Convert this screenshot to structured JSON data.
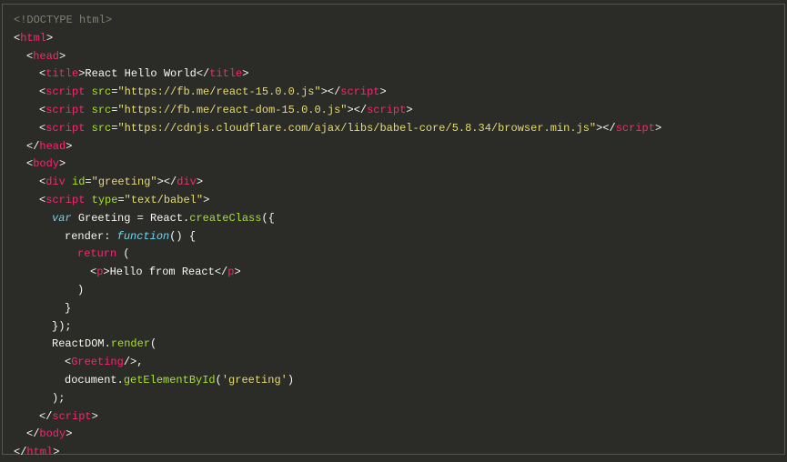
{
  "code": {
    "doctype": "<!DOCTYPE html>",
    "tags": {
      "html": "html",
      "head": "head",
      "title": "title",
      "script": "script",
      "body": "body",
      "div": "div",
      "p": "p",
      "greeting": "Greeting"
    },
    "attrs": {
      "src": "src",
      "id": "id",
      "type": "type"
    },
    "values": {
      "title_text": "React Hello World",
      "src1": "\"https://fb.me/react-15.0.0.js\"",
      "src2": "\"https://fb.me/react-dom-15.0.0.js\"",
      "src3": "\"https://cdnjs.cloudflare.com/ajax/libs/babel-core/5.8.34/browser.min.js\"",
      "div_id": "\"greeting\"",
      "script_type": "\"text/babel\"",
      "hello_text": "Hello from React",
      "greeting_id": "'greeting'"
    },
    "js": {
      "var": "var",
      "greeting_var": "Greeting",
      "eq": " = ",
      "react": "React",
      "createClass": "createClass",
      "render": "render",
      "function": "function",
      "return": "return",
      "reactdom": "ReactDOM",
      "render2": "render",
      "document": "document",
      "getElementById": "getElementById",
      "open_paren_brace": "({",
      "close_brace_paren": "});",
      "open_paren": "(",
      "close_paren": ")",
      "open_brace": " {",
      "close_brace": "}",
      "colon": ": ",
      "dot": ".",
      "comma": ",",
      "paren_pair": "()",
      "semicolon": ";",
      "close_paren_semi": ");"
    },
    "punct": {
      "lt": "<",
      "gt": ">",
      "lt_close": "</",
      "slash_gt": "/>",
      "eq": "="
    }
  }
}
